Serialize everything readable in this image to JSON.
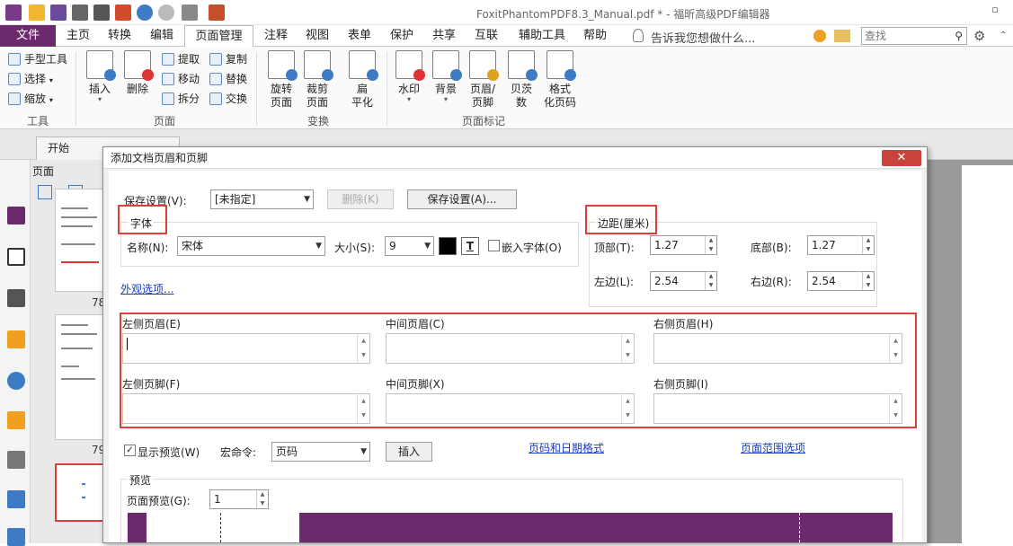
{
  "app": {
    "title": "FoxitPhantomPDF8.3_Manual.pdf * - 福昕高级PDF编辑器"
  },
  "menu": {
    "file": "文件",
    "tabs": [
      "主页",
      "转换",
      "编辑",
      "页面管理",
      "注释",
      "视图",
      "表单",
      "保护",
      "共享",
      "互联",
      "辅助工具",
      "帮助"
    ],
    "tell_me": "告诉我您想做什么...",
    "search_placeholder": "查找"
  },
  "ribbon": {
    "tools": {
      "hand": "手型工具",
      "select": "选择",
      "zoom": "缩放",
      "label": "工具"
    },
    "pages": {
      "insert": "插入",
      "delete": "删除",
      "extract": "提取",
      "move": "移动",
      "split": "拆分",
      "copy": "复制",
      "replace": "替换",
      "swap": "交换",
      "label": "页面"
    },
    "transform": {
      "rotate": "旋转\n页面",
      "crop": "裁剪\n页面",
      "flatten": "扁\n平化",
      "label": "变换"
    },
    "marks": {
      "watermark": "水印",
      "background": "背景",
      "header_footer": "页眉/\n页脚",
      "bates": "贝茨\n数",
      "format_page_num": "格式\n化页码",
      "label": "页面标记"
    }
  },
  "tabstrip": {
    "doc_tab": "开始"
  },
  "thumbs": {
    "panel_title": "页面",
    "page_numbers": [
      "78",
      "79"
    ]
  },
  "dialog": {
    "title": "添加文档页眉和页脚",
    "save_settings_label": "保存设置(V):",
    "settings_value": "[未指定]",
    "delete_btn": "删除(K)",
    "save_btn": "保存设置(A)...",
    "font_group": "字体",
    "font_name_label": "名称(N):",
    "font_name": "宋体",
    "size_label": "大小(S):",
    "size_value": "9",
    "embed_font": "嵌入字体(O)",
    "appearance_link": "外观选项...",
    "margin_group": "边距(厘米)",
    "top_label": "顶部(T):",
    "top_value": "1.27",
    "bottom_label": "底部(B):",
    "bottom_value": "1.27",
    "left_label": "左边(L):",
    "left_value": "2.54",
    "right_label": "右边(R):",
    "right_value": "2.54",
    "left_header": "左侧页眉(E)",
    "center_header": "中间页眉(C)",
    "right_header": "右侧页眉(H)",
    "left_footer": "左侧页脚(F)",
    "center_footer": "中间页脚(X)",
    "right_footer": "右侧页脚(I)",
    "show_preview": "显示预览(W)",
    "macro_label": "宏命令:",
    "macro_value": "页码",
    "insert_btn": "插入",
    "page_date_link": "页码和日期格式",
    "page_range_link": "页面范围选项",
    "preview_group": "预览",
    "page_preview_label": "页面预览(G):",
    "page_preview_value": "1"
  },
  "colors": {
    "accent": "#6a2a6b",
    "highlight": "#e33a3a",
    "link": "#1a3fbf"
  }
}
